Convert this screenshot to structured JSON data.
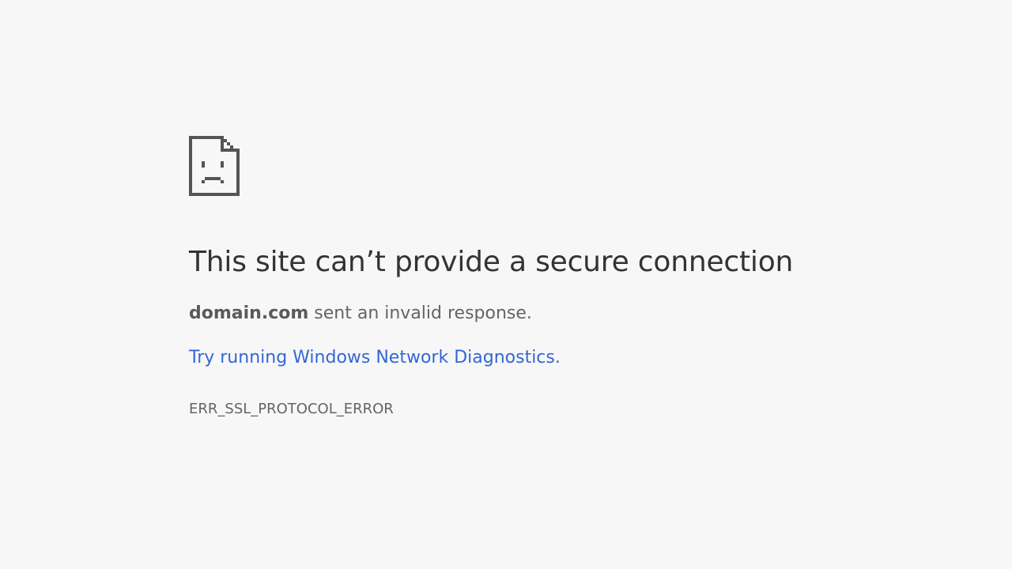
{
  "icon": "sad-page-icon",
  "headline": "This site can’t provide a secure connection",
  "summary": {
    "host": "domain.com",
    "message": " sent an invalid response."
  },
  "diagnostics_link": "Try running Windows Network Diagnostics.",
  "error_code": "ERR_SSL_PROTOCOL_ERROR",
  "colors": {
    "background": "#f7f7f7",
    "link": "#3367d6",
    "icon": "#555555"
  }
}
